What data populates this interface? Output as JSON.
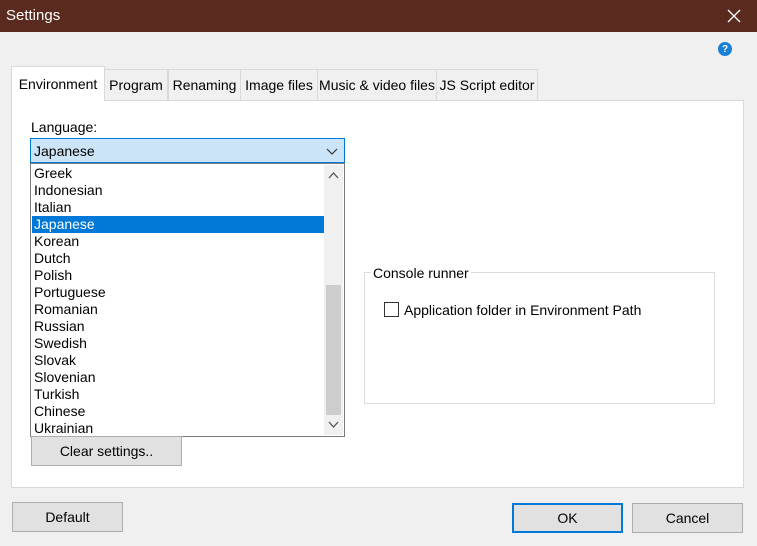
{
  "window": {
    "title": "Settings"
  },
  "icons": {
    "close": "close-icon",
    "help": "help-icon",
    "help_glyph": "?"
  },
  "tabs": [
    {
      "label": "Environment",
      "active": true
    },
    {
      "label": "Program"
    },
    {
      "label": "Renaming"
    },
    {
      "label": "Image files"
    },
    {
      "label": "Music & video files"
    },
    {
      "label": "JS Script editor"
    }
  ],
  "language": {
    "label": "Language:",
    "selected": "Japanese",
    "options": [
      "Greek",
      "Indonesian",
      "Italian",
      "Japanese",
      "Korean",
      "Dutch",
      "Polish",
      "Portuguese",
      "Romanian",
      "Russian",
      "Swedish",
      "Slovak",
      "Slovenian",
      "Turkish",
      "Chinese",
      "Ukrainian"
    ]
  },
  "console_runner": {
    "title": "Console runner",
    "checkbox_label": "Application folder in Environment Path",
    "checked": false
  },
  "buttons": {
    "clear_settings": "Clear settings..",
    "default": "Default",
    "ok": "OK",
    "cancel": "Cancel"
  },
  "colors": {
    "titlebar": "#5a2a1e",
    "accent": "#0078d7",
    "combo_bg": "#cce4f7"
  }
}
